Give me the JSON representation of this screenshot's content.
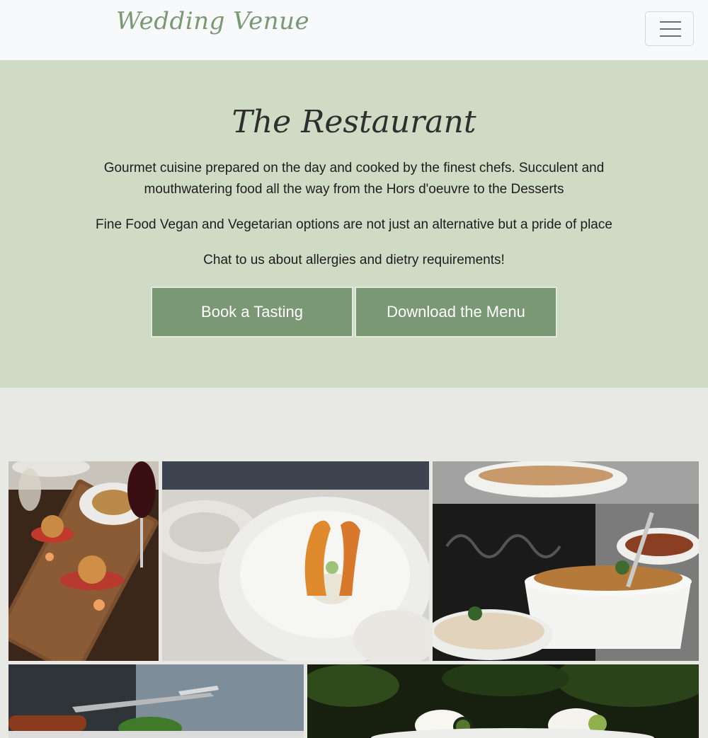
{
  "navbar": {
    "brand": "Wedding Venue",
    "toggle_icon": "hamburger-icon"
  },
  "hero": {
    "title": "The Restaurant",
    "paragraphs": [
      "Gourmet cuisine prepared on the day and cooked by the finest chefs. Succulent and mouthwatering food all the way from the Hors d'oeuvre to the Desserts",
      "Fine Food Vegan and Vegetarian options are not just an alternative but a pride of place",
      "Chat to us about allergies and dietry requirements!"
    ],
    "buttons": {
      "tasting": "Book a Tasting",
      "menu": "Download the Menu"
    }
  },
  "colors": {
    "navbar_bg": "#f8f9fa",
    "brand": "#7b9874",
    "hero_bg": "#d0dbc6",
    "button_bg": "#7a9874",
    "page_bg": "#e8e9e5"
  },
  "gallery": {
    "photos": [
      {
        "name": "scallops-on-board"
      },
      {
        "name": "shrimp-in-bowl"
      },
      {
        "name": "buffet-dishes"
      },
      {
        "name": "fork-and-greens"
      },
      {
        "name": "dessert-with-cream"
      }
    ]
  }
}
